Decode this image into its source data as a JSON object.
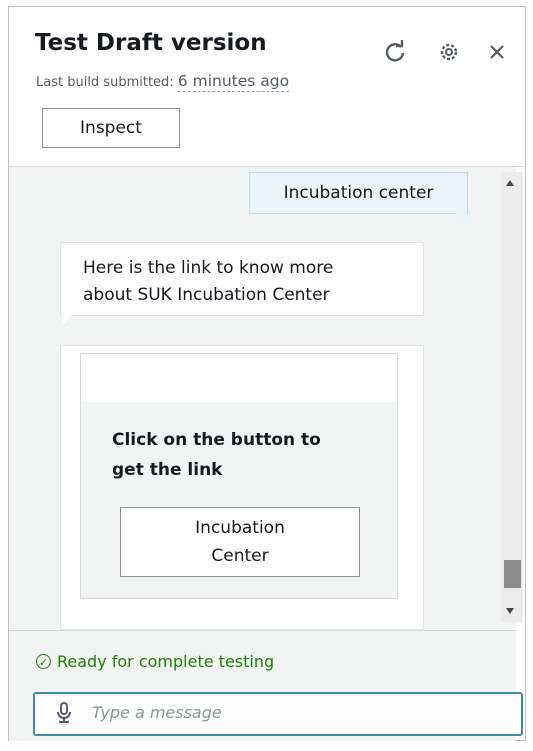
{
  "header": {
    "title": "Test Draft version",
    "build_label": "Last build submitted:",
    "build_time": "6 minutes ago",
    "inspect_label": "Inspect"
  },
  "icons": {
    "refresh": "refresh-icon",
    "settings": "gear-icon",
    "close": "close-icon"
  },
  "conversation": {
    "user_message": "Incubation center",
    "bot_message_line1": "Here is the link to know more",
    "bot_message_line2": "about SUK Incubation Center",
    "card": {
      "text_line1": "Click on the button to",
      "text_line2": "get the link",
      "button_line1": "Incubation",
      "button_line2": "Center"
    }
  },
  "footer": {
    "status": "Ready for complete testing",
    "input_placeholder": "Type a message"
  },
  "colors": {
    "accent": "#3a8ca3",
    "status_green": "#1d8102",
    "user_bubble": "#e9f4fb"
  }
}
